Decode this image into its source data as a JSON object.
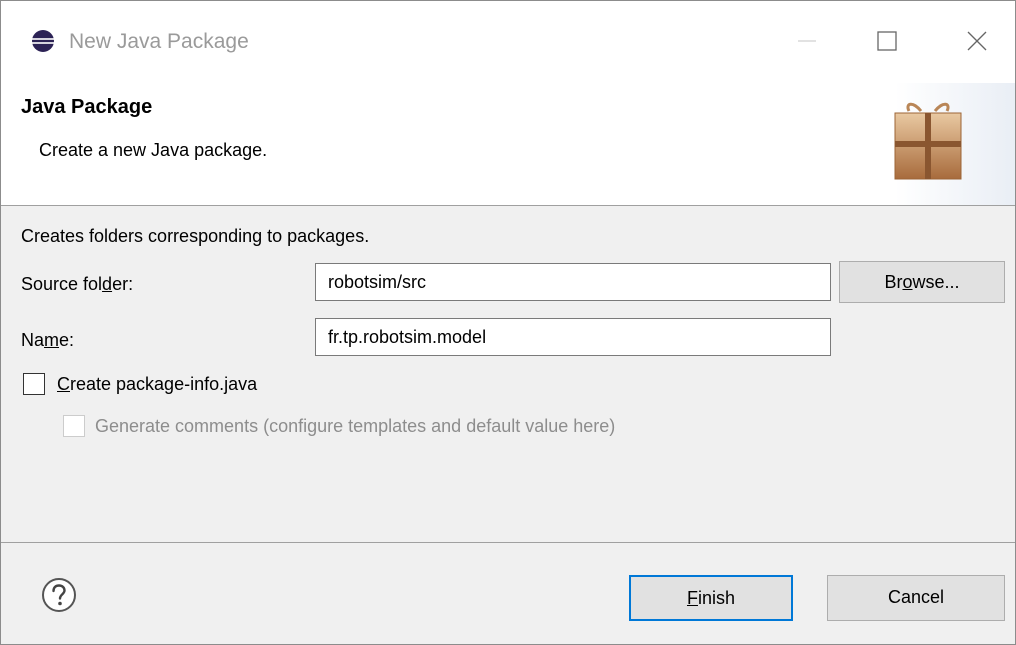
{
  "window": {
    "title": "New Java Package",
    "icon": "eclipse-icon"
  },
  "banner": {
    "title": "Java Package",
    "description": "Create a new Java package.",
    "icon": "package-gift-icon"
  },
  "form": {
    "intro": "Creates folders corresponding to packages.",
    "source_folder": {
      "label_pre": "Source fol",
      "label_mnemonic": "d",
      "label_post": "er:",
      "value": "robotsim/src"
    },
    "browse": {
      "label_pre": "Br",
      "label_mnemonic": "o",
      "label_post": "wse..."
    },
    "name": {
      "label_pre": "Na",
      "label_mnemonic": "m",
      "label_post": "e:",
      "value": "fr.tp.robotsim.model"
    },
    "create_package_info": {
      "label_mnemonic": "C",
      "label_post": "reate package-info.java",
      "checked": false
    },
    "generate_comments": {
      "label": "Generate comments  (configure templates and default value here)",
      "checked": false,
      "enabled": false
    }
  },
  "footer": {
    "help_icon": "help-icon",
    "finish": {
      "label_mnemonic": "F",
      "label_post": "inish"
    },
    "cancel": {
      "label": "Cancel"
    }
  },
  "colors": {
    "accent": "#0078d7",
    "dialog_bg": "#f0f0f0",
    "button_bg": "#e1e1e1"
  }
}
